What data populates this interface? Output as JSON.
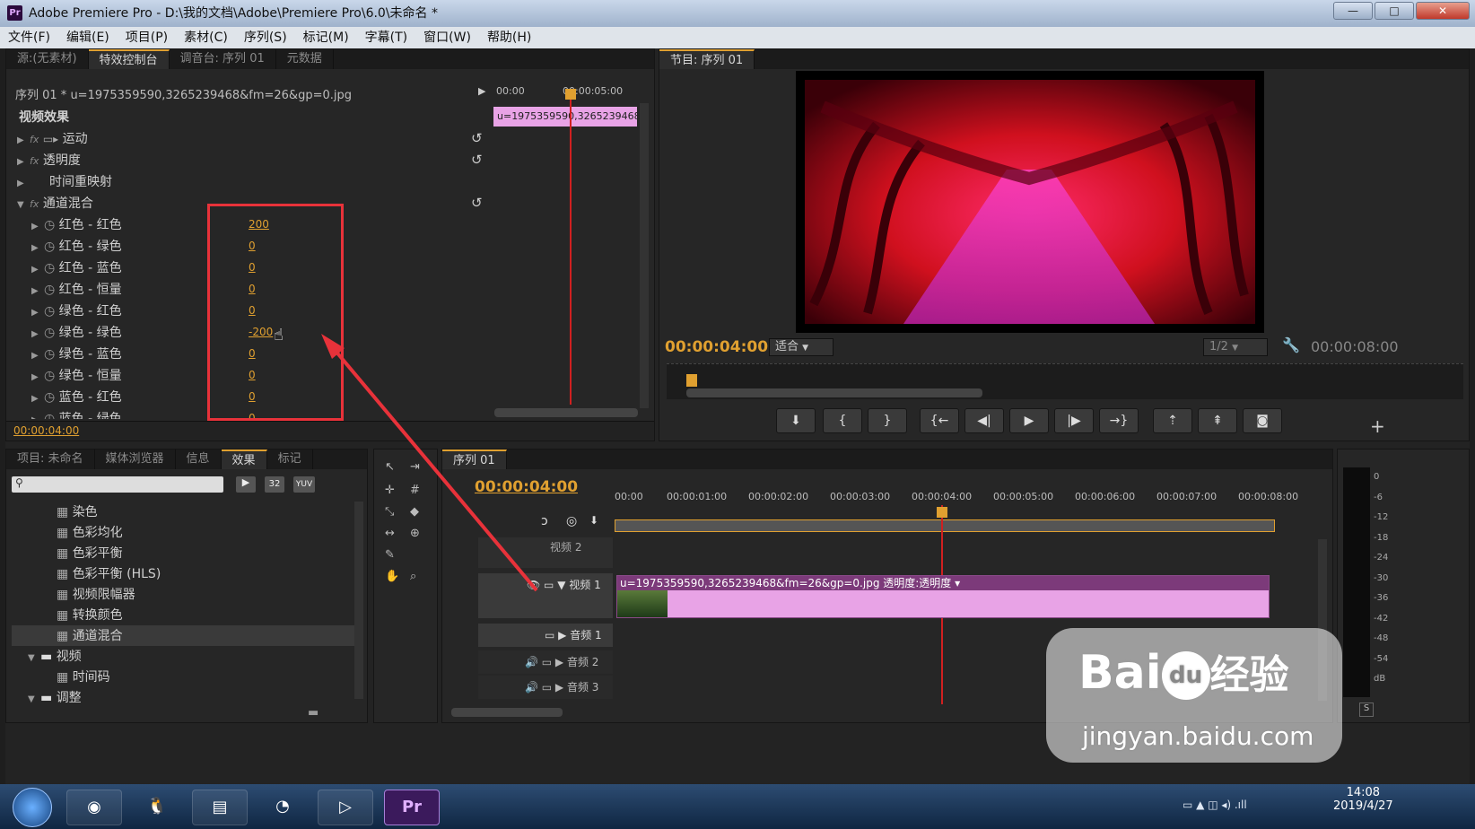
{
  "window": {
    "title": "Adobe Premiere Pro - D:\\我的文档\\Adobe\\Premiere Pro\\6.0\\未命名 *",
    "logo": "Pr",
    "minimize": "—",
    "maximize": "□",
    "close": "✕"
  },
  "menu": [
    "文件(F)",
    "编辑(E)",
    "项目(P)",
    "素材(C)",
    "序列(S)",
    "标记(M)",
    "字幕(T)",
    "窗口(W)",
    "帮助(H)"
  ],
  "source_panel": {
    "tabs": [
      "源:(无素材)",
      "特效控制台",
      "调音台: 序列 01",
      "元数据"
    ],
    "clip_path": "序列 01 * u=1975359590,3265239468&fm=26&gp=0.jpg",
    "ruler": [
      "00:00",
      "00:00:05:00"
    ],
    "clip_label": "u=1975359590,3265239468",
    "section": "视频效果",
    "effects": [
      {
        "name": "运动",
        "fx": true
      },
      {
        "name": "透明度",
        "fx": true
      },
      {
        "name": "时间重映射",
        "fx": false
      },
      {
        "name": "通道混合",
        "fx": true
      }
    ],
    "params": [
      {
        "name": "红色 - 红色",
        "value": "200"
      },
      {
        "name": "红色 - 绿色",
        "value": "0"
      },
      {
        "name": "红色 - 蓝色",
        "value": "0"
      },
      {
        "name": "红色 - 恒量",
        "value": "0"
      },
      {
        "name": "绿色 - 红色",
        "value": "0"
      },
      {
        "name": "绿色 - 绿色",
        "value": "-200"
      },
      {
        "name": "绿色 - 蓝色",
        "value": "0"
      },
      {
        "name": "绿色 - 恒量",
        "value": "0"
      },
      {
        "name": "蓝色 - 红色",
        "value": "0"
      },
      {
        "name": "蓝色 - 绿色",
        "value": "0"
      }
    ],
    "timecode": "00:00:04:00"
  },
  "program_panel": {
    "tab": "节目: 序列 01",
    "timecode": "00:00:04:00",
    "fit": "适合",
    "resolution": "1/2",
    "duration": "00:00:08:00",
    "add": "+"
  },
  "project_panel": {
    "tabs": [
      "项目: 未命名",
      "媒体浏览器",
      "信息",
      "效果",
      "标记"
    ],
    "search_placeholder": "",
    "badges": [
      "32",
      "YUV"
    ],
    "items": [
      {
        "label": "染色",
        "indent": 2
      },
      {
        "label": "色彩均化",
        "indent": 2
      },
      {
        "label": "色彩平衡",
        "indent": 2
      },
      {
        "label": "色彩平衡 (HLS)",
        "indent": 2
      },
      {
        "label": "视频限幅器",
        "indent": 2
      },
      {
        "label": "转换颜色",
        "indent": 2
      },
      {
        "label": "通道混合",
        "indent": 2,
        "selected": true
      },
      {
        "label": "视频",
        "indent": 1,
        "folder": true
      },
      {
        "label": "时间码",
        "indent": 2
      },
      {
        "label": "调整",
        "indent": 1,
        "folder": true
      }
    ]
  },
  "timeline": {
    "tab": "序列 01",
    "timecode": "00:00:04:00",
    "ruler": [
      "00:00",
      "00:00:01:00",
      "00:00:02:00",
      "00:00:03:00",
      "00:00:04:00",
      "00:00:05:00",
      "00:00:06:00",
      "00:00:07:00",
      "00:00:08:00"
    ],
    "tracks": [
      "视频 2",
      "视频 1",
      "音频 1",
      "音频 2",
      "音频 3"
    ],
    "clip_label": "u=1975359590,3265239468&fm=26&gp=0.jpg",
    "clip_fx": "透明度:透明度"
  },
  "meter": {
    "ticks": [
      "0",
      "-6",
      "-12",
      "-18",
      "-24",
      "-30",
      "-36",
      "-42",
      "-48",
      "-54",
      "dB"
    ],
    "solo": "S"
  },
  "taskbar": {
    "time": "14:08",
    "date": "2019/4/27",
    "apps": [
      "Pr"
    ]
  },
  "watermark": {
    "brand": "Bai",
    "paw": "du",
    "cn": "经验",
    "url": "jingyan.baidu.com"
  },
  "colors": {
    "accent": "#e0a030",
    "clip_pink": "#e8a3e6",
    "annotation": "#e8323a"
  }
}
